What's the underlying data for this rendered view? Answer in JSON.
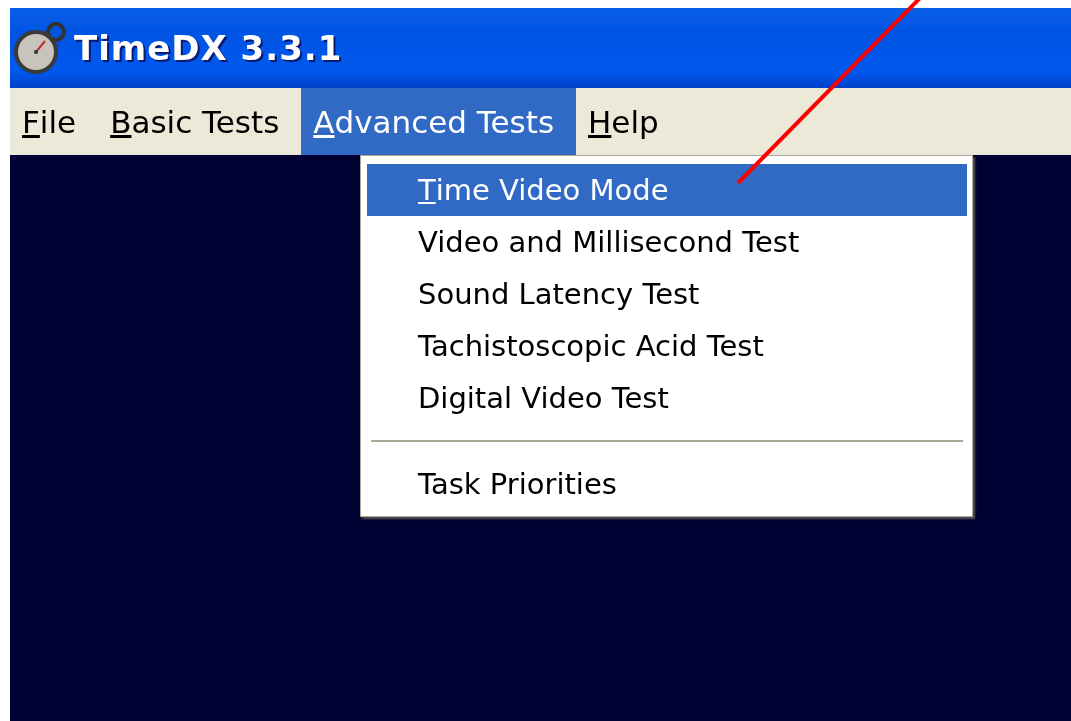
{
  "window": {
    "title": "TimeDX 3.3.1"
  },
  "menu_bar": [
    {
      "mnemonic": "F",
      "label_rest": "ile",
      "selected": false
    },
    {
      "mnemonic": "B",
      "label_rest": "asic Tests",
      "selected": false
    },
    {
      "mnemonic": "A",
      "label_rest": "dvanced Tests",
      "selected": true
    },
    {
      "mnemonic": "H",
      "label_rest": "elp",
      "selected": false
    }
  ],
  "dropdown_menu": {
    "items": [
      {
        "kind": "item",
        "mnemonic": "T",
        "label_rest": "ime Video Mode",
        "selected": true
      },
      {
        "kind": "item",
        "label": "Video and Millisecond Test",
        "selected": false
      },
      {
        "kind": "item",
        "label": "Sound Latency Test",
        "selected": false
      },
      {
        "kind": "item",
        "label": "Tachistoscopic Acid Test",
        "selected": false
      },
      {
        "kind": "item",
        "label": "Digital Video Test",
        "selected": false
      },
      {
        "kind": "separator"
      },
      {
        "kind": "item",
        "label": "Task Priorities",
        "selected": false
      }
    ]
  }
}
